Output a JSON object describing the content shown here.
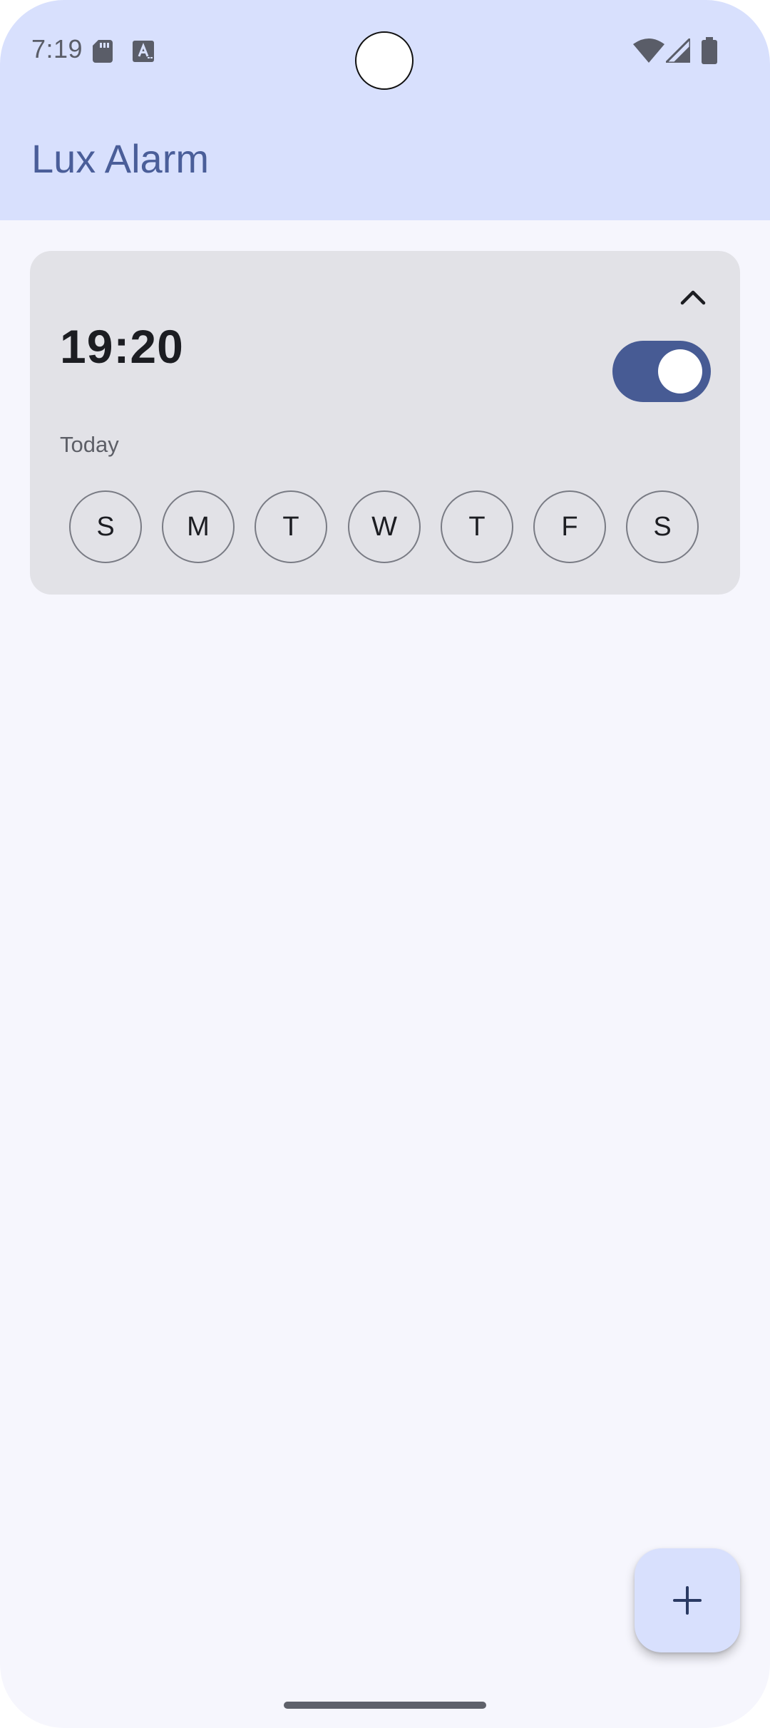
{
  "status_bar": {
    "time": "7:19",
    "icons": [
      "sd-card-icon",
      "keyboard-a-icon",
      "wifi-icon",
      "cell-signal-icon",
      "battery-icon"
    ]
  },
  "app_bar": {
    "title": "Lux Alarm"
  },
  "alarms": [
    {
      "time": "19:20",
      "label": "Today",
      "enabled": true,
      "expanded": true,
      "days": [
        "S",
        "M",
        "T",
        "W",
        "T",
        "F",
        "S"
      ]
    }
  ],
  "fab": {
    "icon": "plus-icon"
  },
  "colors": {
    "primary": "#475b94",
    "header_bg": "#d8e0fd",
    "screen_bg": "#f6f6fd",
    "card_bg": "#e2e2e7",
    "title": "#4a5e99"
  }
}
